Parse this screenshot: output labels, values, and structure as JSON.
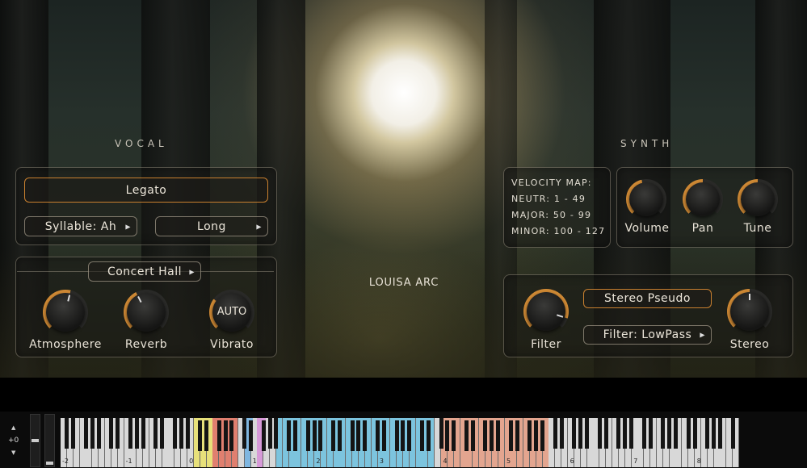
{
  "instrument_name": "LOUISA ARC",
  "vocal": {
    "title": "VOCAL",
    "articulation": "Legato",
    "syllable": "Syllable: Ah",
    "length": "Long",
    "room": "Concert Hall",
    "knobs": [
      {
        "label": "Atmosphere",
        "value": 0.55
      },
      {
        "label": "Reverb",
        "value": 0.4
      },
      {
        "label": "Vibrato",
        "value": 0.3,
        "text": "AUTO"
      }
    ]
  },
  "synth": {
    "title": "SYNTH",
    "velocity_map": {
      "title": "VELOCITY MAP:",
      "lines": [
        "NEUTR: 1 - 49",
        "MAJOR: 50 - 99",
        "MINOR: 100 - 127"
      ]
    },
    "knobs": [
      {
        "label": "Volume",
        "value": 0.45
      },
      {
        "label": "Pan",
        "value": 0.5
      },
      {
        "label": "Tune",
        "value": 0.5
      }
    ],
    "stereo_mode": "Stereo Pseudo",
    "filter_type": "Filter: LowPass",
    "filter_knob": {
      "label": "Filter",
      "value": 0.9
    },
    "stereo_knob": {
      "label": "Stereo",
      "value": 0.5
    }
  },
  "keyboard": {
    "transpose_value": "+0",
    "up_arrow": "▲",
    "down_arrow": "▼",
    "octave_labels": [
      "-2",
      "-1",
      "0",
      "1",
      "2",
      "3",
      "4",
      "5",
      "6",
      "7",
      "8"
    ],
    "zone_colors": {
      "yellow": "#e7e07a",
      "red": "#e07f6f",
      "blue": "#7fb6e0",
      "pink": "#d79ad8",
      "cyan": "#7cc4de",
      "salmon": "#e3a58f"
    },
    "accent": "#d08a35"
  }
}
